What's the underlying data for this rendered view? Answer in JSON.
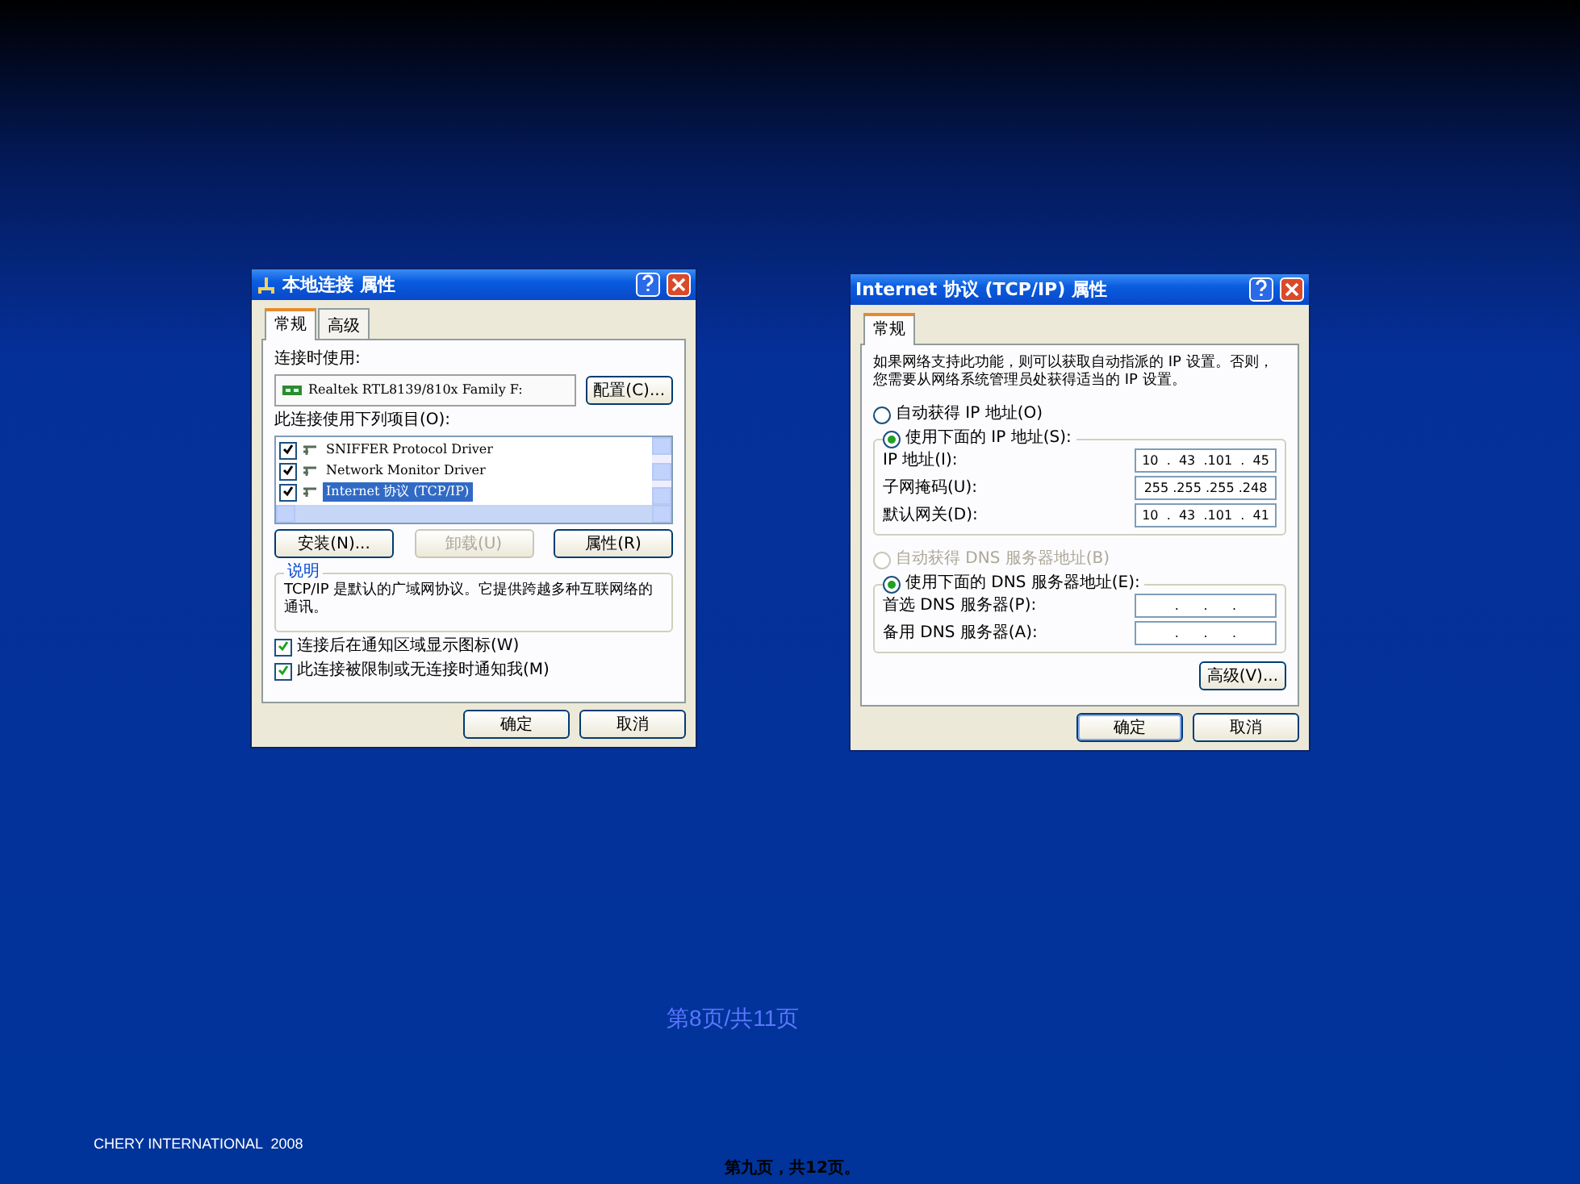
{
  "slide": {
    "page_label": "第8页/共11页",
    "footer": "CHERY INTERNATIONAL  2008",
    "page_note": "第九页，共12页。"
  },
  "dialogs": [
    {
      "kind": "connection",
      "title": "本地连接 属性",
      "tabs": [
        {
          "label": "常规",
          "selected": true
        },
        {
          "label": "高级",
          "selected": false
        }
      ],
      "connect_label": "连接时使用:",
      "adapter": "Realtek RTL8139/810x Family F:",
      "configure_button": "配置(C)...",
      "items_label": "此连接使用下列项目(O):",
      "items": [
        {
          "label": "SNIFFER Protocol Driver",
          "checked": true,
          "selected": false
        },
        {
          "label": "Network Monitor Driver",
          "checked": true,
          "selected": false
        },
        {
          "label": "Internet 协议 (TCP/IP)",
          "checked": true,
          "selected": true
        }
      ],
      "item_buttons": [
        {
          "label": "安装(N)...",
          "disabled": false
        },
        {
          "label": "卸载(U)",
          "disabled": true
        },
        {
          "label": "属性(R)",
          "disabled": false
        }
      ],
      "description_title": "说明",
      "description": "TCP/IP 是默认的广域网协议。它提供跨越多种互联网络的通讯。",
      "options": [
        {
          "label": "连接后在通知区域显示图标(W)",
          "checked": true
        },
        {
          "label": "此连接被限制或无连接时通知我(M)",
          "checked": true
        }
      ],
      "footer_buttons": [
        {
          "label": "确定",
          "default": false
        },
        {
          "label": "取消",
          "default": false
        }
      ]
    },
    {
      "kind": "tcpip",
      "title": "Internet 协议 (TCP/IP) 属性",
      "tabs": [
        {
          "label": "常规",
          "selected": true
        }
      ],
      "intro": "如果网络支持此功能，则可以获取自动指派的 IP 设置。否则，您需要从网络系统管理员处获得适当的 IP 设置。",
      "ip_modes": [
        {
          "label": "自动获得 IP 地址(O)",
          "selected": false,
          "disabled": false
        },
        {
          "label": "使用下面的 IP 地址(S):",
          "selected": true,
          "disabled": false
        }
      ],
      "ip_fields": [
        {
          "label": "IP 地址(I):",
          "value": "10  .  43  .101  .  45"
        },
        {
          "label": "子网掩码(U):",
          "value": "255 .255 .255 .248"
        },
        {
          "label": "默认网关(D):",
          "value": "10  .  43  .101  .  41"
        }
      ],
      "dns_modes": [
        {
          "label": "自动获得 DNS 服务器地址(B)",
          "selected": false,
          "disabled": true
        },
        {
          "label": "使用下面的 DNS 服务器地址(E):",
          "selected": true,
          "disabled": false
        }
      ],
      "dns_fields": [
        {
          "label": "首选 DNS 服务器(P):",
          "value": ".      .      ."
        },
        {
          "label": "备用 DNS 服务器(A):",
          "value": ".      .      ."
        }
      ],
      "advanced_button": "高级(V)...",
      "footer_buttons": [
        {
          "label": "确定",
          "default": true
        },
        {
          "label": "取消",
          "default": false
        }
      ]
    }
  ]
}
